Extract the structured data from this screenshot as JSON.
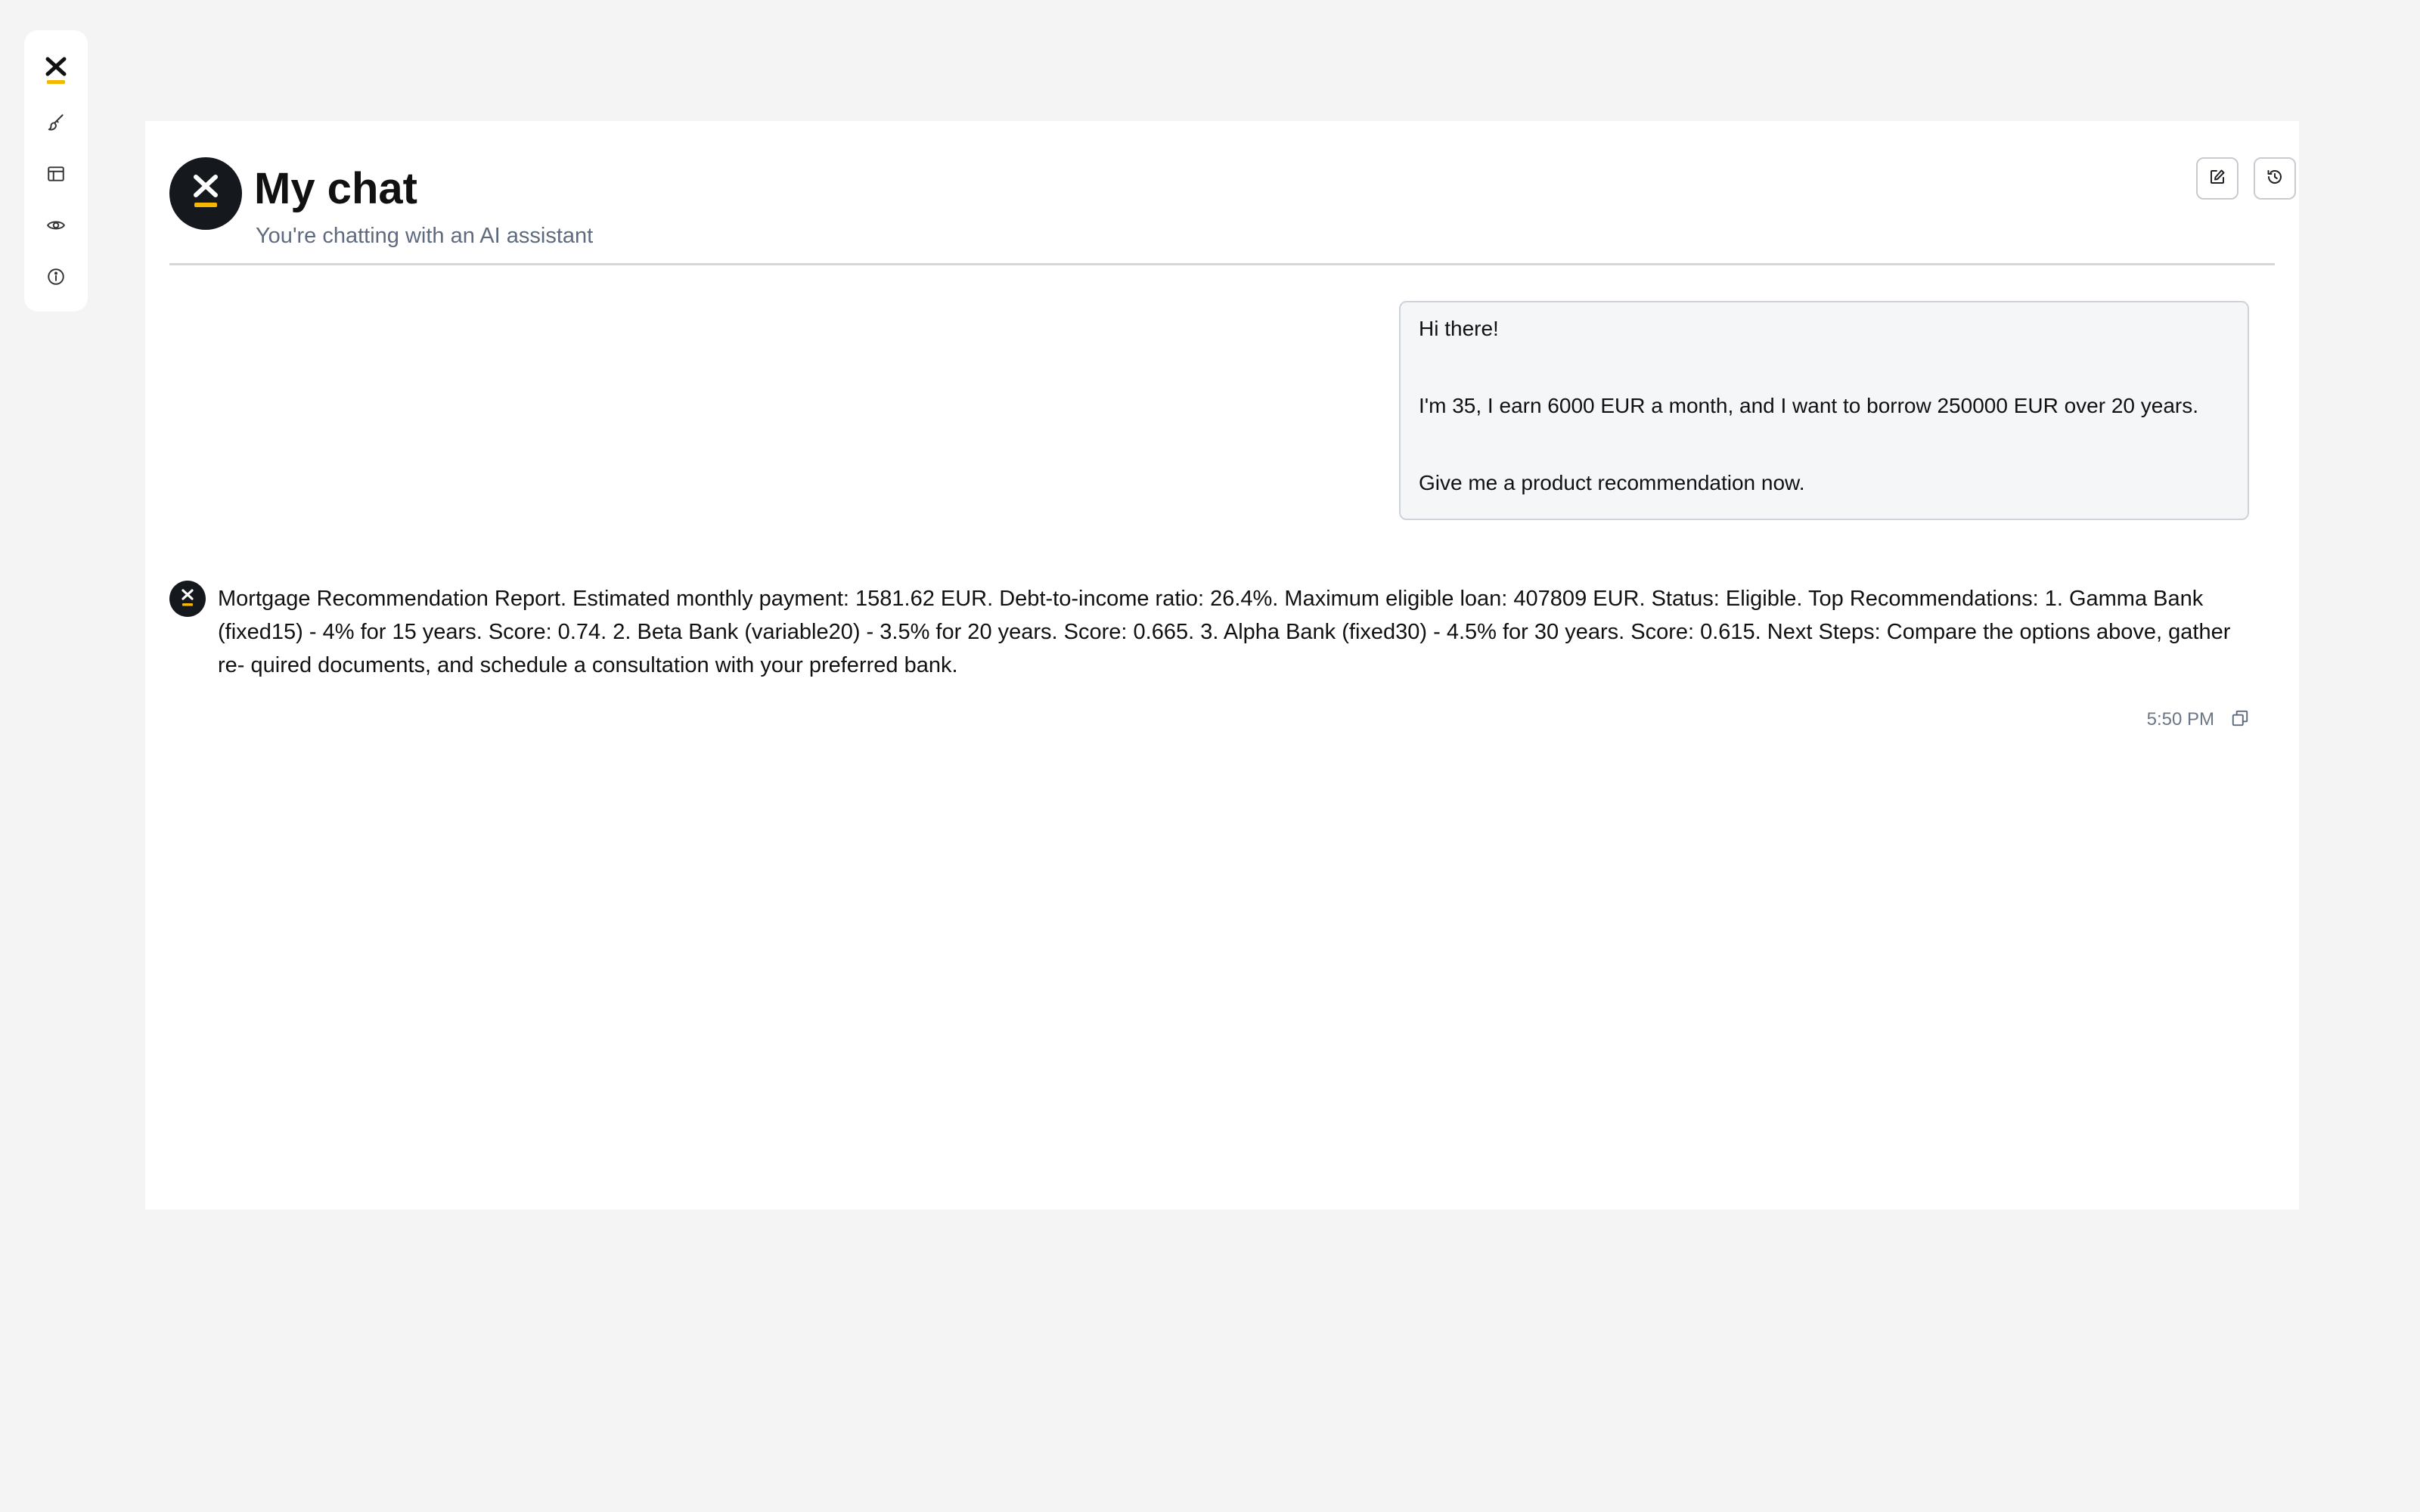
{
  "sidebar": {
    "items": [
      {
        "icon": "logo-x-icon",
        "label": ""
      },
      {
        "icon": "brush-icon",
        "label": ""
      },
      {
        "icon": "layout-icon",
        "label": ""
      },
      {
        "icon": "eye-icon",
        "label": ""
      },
      {
        "icon": "info-icon",
        "label": ""
      }
    ]
  },
  "header": {
    "title": "My chat",
    "subtitle": "You're chatting with an AI assistant",
    "actions": [
      {
        "icon": "edit-icon"
      },
      {
        "icon": "history-icon"
      }
    ]
  },
  "messages": {
    "user": {
      "lines": [
        "Hi there!",
        "I'm 35, I earn 6000 EUR a month, and I want to borrow 250000 EUR over 20 years.",
        "Give me a product recommendation now."
      ]
    },
    "assistant": {
      "text": "Mortgage Recommendation Report. Estimated monthly payment: 1581.62 EUR. Debt-to-income ratio: 26.4%. Maximum eligible loan: 407809 EUR. Status: Eligible. Top Recommendations: 1. Gamma Bank (fixed15) - 4% for 15 years. Score: 0.74. 2. Beta Bank (variable20) - 3.5% for 20 years. Score: 0.665. 3. Alpha Bank (fixed30) - 4.5% for 30 years. Score: 0.615. Next Steps: Compare the options above, gather re- quired documents, and schedule a consultation with your preferred bank.",
      "timestamp": "5:50 PM",
      "copy_icon": "copy-icon"
    }
  },
  "colors": {
    "background": "#f4f4f4",
    "panel": "#ffffff",
    "brand_dark": "#15181d",
    "brand_accent": "#f5b700",
    "muted_text": "#5e6b7e",
    "bubble_bg": "#f5f6f8",
    "bubble_border": "#cfd3d9"
  }
}
